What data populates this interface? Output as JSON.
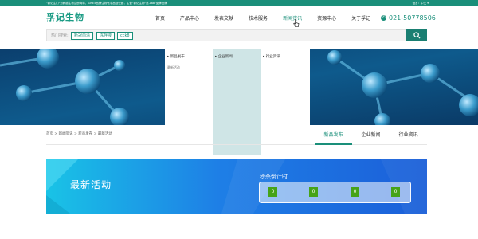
{
  "topbar": {
    "notice": "\"雾记生门\"为跨越生物注册商标，SIRE5品牌生物化学品及仪器，主营\"雾记生物\"丝-Lab\"品牌品牌",
    "language": "语言：中文 ▾"
  },
  "logo": {
    "name_cn": "孚记生物",
    "name_en": "Life-iLab"
  },
  "nav": {
    "items": [
      {
        "label": "首页"
      },
      {
        "label": "产品中心"
      },
      {
        "label": "发表文献"
      },
      {
        "label": "技术服务"
      },
      {
        "label": "新闻资讯"
      },
      {
        "label": "资源中心"
      },
      {
        "label": "关于孚记"
      }
    ]
  },
  "phone": {
    "number": "021-50778506"
  },
  "search": {
    "hot_label": "热门搜索:",
    "tags": [
      {
        "label": "新冠血清"
      },
      {
        "label": "冻存液"
      },
      {
        "label": "cck8"
      }
    ]
  },
  "dropdown": {
    "col1": {
      "label": "新品发布",
      "sub": "最新活动"
    },
    "col2": {
      "label": "企业新闻"
    },
    "col3": {
      "label": "行业资讯"
    }
  },
  "breadcrumb": {
    "text": "首页 > 新闻资讯 > 新品发布 > 最新活动"
  },
  "tabs": {
    "items": [
      {
        "label": "新品发布"
      },
      {
        "label": "企业新闻"
      },
      {
        "label": "行业资讯"
      }
    ]
  },
  "promo": {
    "title": "最新活动",
    "countdown_label": "秒杀倒计时",
    "digits": [
      "0",
      "0",
      "0",
      "0"
    ]
  },
  "colors": {
    "brand": "#1a8f7a",
    "countdown_digit": "#46a317",
    "dropdown_highlight": "#cfe5e6"
  }
}
